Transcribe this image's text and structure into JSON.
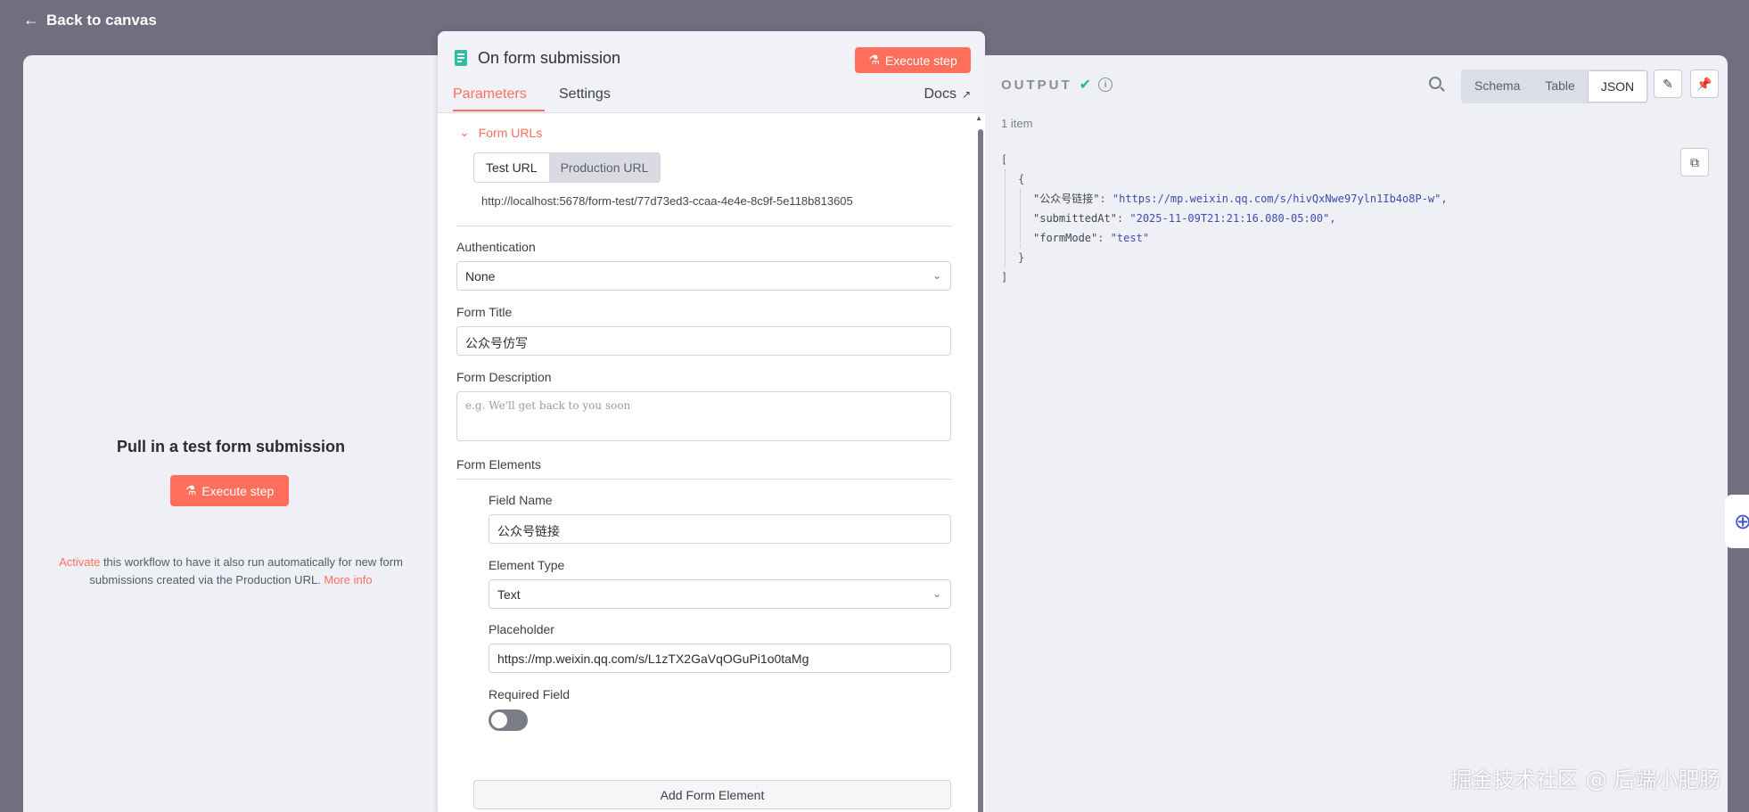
{
  "nav": {
    "back_label": "Back to canvas"
  },
  "left": {
    "title": "Pull in a test form submission",
    "exec_label": "Execute step",
    "note_accent": "Activate",
    "note_text": " this workflow to have it also run automatically for new form submissions created via the Production URL. ",
    "note_link": "More info"
  },
  "node": {
    "title": "On form submission",
    "exec_label": "Execute step",
    "tabs": {
      "params": "Parameters",
      "settings": "Settings",
      "docs": "Docs"
    },
    "form_urls": {
      "section_label": "Form URLs",
      "test_tab": "Test URL",
      "prod_tab": "Production URL",
      "url": "http://localhost:5678/form-test/77d73ed3-ccaa-4e4e-8c9f-5e118b813605"
    },
    "auth": {
      "label": "Authentication",
      "value": "None"
    },
    "form_title": {
      "label": "Form Title",
      "value": "公众号仿写"
    },
    "form_desc": {
      "label": "Form Description",
      "placeholder": "e.g. We'll get back to you soon"
    },
    "form_elements": {
      "label": "Form Elements",
      "field_name_label": "Field Name",
      "field_name_value": "公众号链接",
      "element_type_label": "Element Type",
      "element_type_value": "Text",
      "placeholder_label": "Placeholder",
      "placeholder_value": "https://mp.weixin.qq.com/s/L1zTX2GaVqOGuPi1o0taMg",
      "required_label": "Required Field",
      "required_on": false,
      "add_label": "Add Form Element"
    }
  },
  "output": {
    "title": "OUTPUT",
    "views": [
      "Schema",
      "Table",
      "JSON"
    ],
    "active_view": "JSON",
    "items_count": "1 item",
    "json": {
      "open_bracket": "[",
      "open_brace": "{",
      "rows": [
        {
          "key": "\"公众号链接\"",
          "value": "\"https://mp.weixin.qq.com/s/hivQxNwe97yln1Ib4o8P-w\"",
          "comma": ","
        },
        {
          "key": "\"submittedAt\"",
          "value": "\"2025-11-09T21:21:16.080-05:00\"",
          "comma": ","
        },
        {
          "key": "\"formMode\"",
          "value": "\"test\"",
          "comma": ""
        }
      ],
      "close_brace": "}",
      "close_bracket": "]"
    }
  },
  "watermark": "掘金技术社区 @ 后端小肥肠",
  "colors": {
    "accent": "#ff6f5c",
    "success": "#2fb57e",
    "json_string": "#3f4bb0"
  }
}
